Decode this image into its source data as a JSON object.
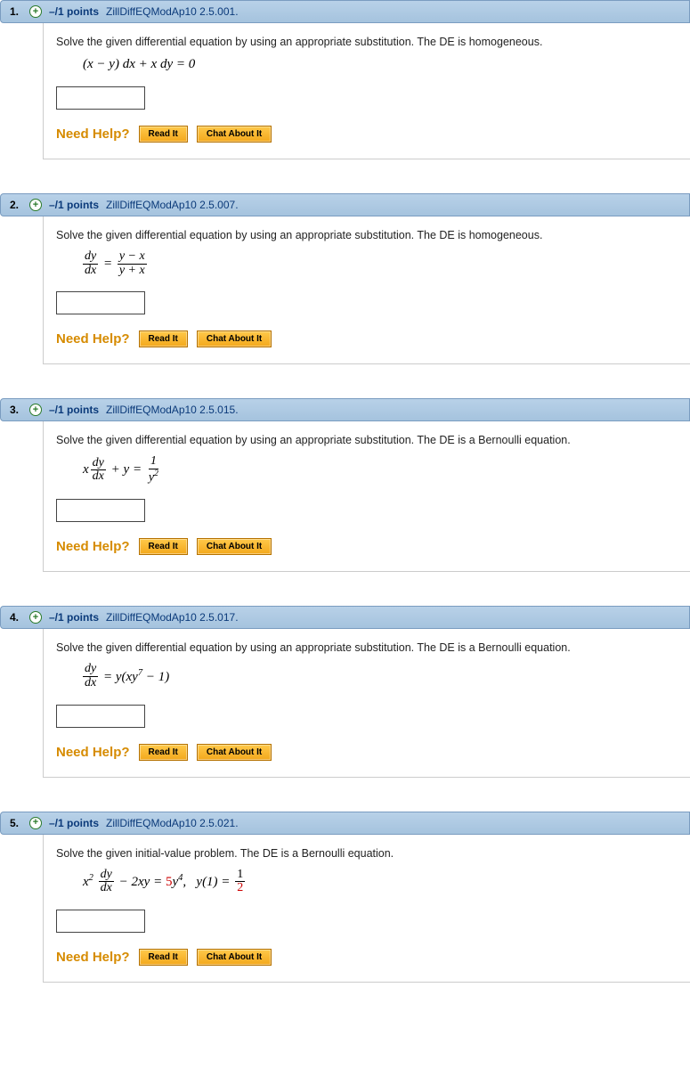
{
  "help": {
    "label": "Need Help?",
    "read": "Read It",
    "chat": "Chat About It"
  },
  "questions": [
    {
      "num": "1.",
      "points": "–/1 points",
      "source": "ZillDiffEQModAp10 2.5.001.",
      "prompt": "Solve the given differential equation by using an appropriate substitution. The DE is homogeneous.",
      "eq_key": "eq1"
    },
    {
      "num": "2.",
      "points": "–/1 points",
      "source": "ZillDiffEQModAp10 2.5.007.",
      "prompt": "Solve the given differential equation by using an appropriate substitution. The DE is homogeneous.",
      "eq_key": "eq2"
    },
    {
      "num": "3.",
      "points": "–/1 points",
      "source": "ZillDiffEQModAp10 2.5.015.",
      "prompt": "Solve the given differential equation by using an appropriate substitution. The DE is a Bernoulli equation.",
      "eq_key": "eq3"
    },
    {
      "num": "4.",
      "points": "–/1 points",
      "source": "ZillDiffEQModAp10 2.5.017.",
      "prompt": "Solve the given differential equation by using an appropriate substitution. The DE is a Bernoulli equation.",
      "eq_key": "eq4"
    },
    {
      "num": "5.",
      "points": "–/1 points",
      "source": "ZillDiffEQModAp10 2.5.021.",
      "prompt": "Solve the given initial-value problem. The DE is a Bernoulli equation.",
      "eq_key": "eq5"
    }
  ],
  "equations": {
    "eq1": "(x − y) dx + x dy = 0",
    "eq2": "dy/dx = (y − x)/(y + x)",
    "eq3": "x dy/dx + y = 1/y^2",
    "eq4": "dy/dx = y(xy^7 − 1)",
    "eq5": "x^2 dy/dx − 2xy = 5y^4,   y(1) = 1/2"
  }
}
